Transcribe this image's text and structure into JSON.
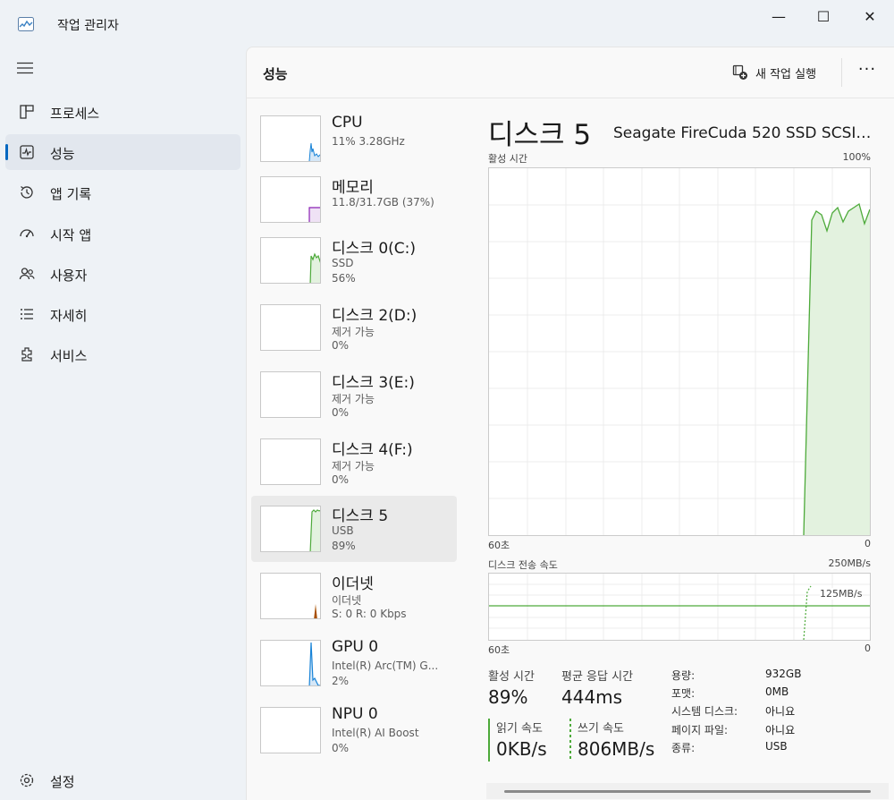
{
  "window": {
    "title": "작업 관리자",
    "minimize": "—",
    "maximize": "☐",
    "close": "✕"
  },
  "nav": {
    "items": [
      {
        "label": "프로세스",
        "icon": "processes-icon"
      },
      {
        "label": "성능",
        "icon": "performance-icon"
      },
      {
        "label": "앱 기록",
        "icon": "app-history-icon"
      },
      {
        "label": "시작 앱",
        "icon": "startup-apps-icon"
      },
      {
        "label": "사용자",
        "icon": "users-icon"
      },
      {
        "label": "자세히",
        "icon": "details-icon"
      },
      {
        "label": "서비스",
        "icon": "services-icon"
      }
    ],
    "settings_label": "설정"
  },
  "header": {
    "title": "성능",
    "new_task_label": "새 작업 실행",
    "more_label": "···"
  },
  "devices": [
    {
      "name": "CPU",
      "sub1": "11% 3.28GHz",
      "sub2": "",
      "color": "#1883d7"
    },
    {
      "name": "메모리",
      "sub1": "11.8/31.7GB (37%)",
      "sub2": "",
      "color": "#8b21b5"
    },
    {
      "name": "디스크 0(C:)",
      "sub1": "SSD",
      "sub2": "56%",
      "color": "#4daa3a"
    },
    {
      "name": "디스크 2(D:)",
      "sub1": "제거 가능",
      "sub2": "0%",
      "color": "#4daa3a"
    },
    {
      "name": "디스크 3(E:)",
      "sub1": "제거 가능",
      "sub2": "0%",
      "color": "#4daa3a"
    },
    {
      "name": "디스크 4(F:)",
      "sub1": "제거 가능",
      "sub2": "0%",
      "color": "#4daa3a"
    },
    {
      "name": "디스크 5",
      "sub1": "USB",
      "sub2": "89%",
      "color": "#4daa3a"
    },
    {
      "name": "이더넷",
      "sub1": "이더넷",
      "sub2": "S: 0 R: 0 Kbps",
      "color": "#a74f01"
    },
    {
      "name": "GPU 0",
      "sub1": "Intel(R) Arc(TM) G...",
      "sub2": "2%",
      "color": "#1883d7"
    },
    {
      "name": "NPU 0",
      "sub1": "Intel(R) AI Boost",
      "sub2": "0%",
      "color": "#1883d7"
    }
  ],
  "detail": {
    "title": "디스크 5",
    "model": "Seagate FireCuda 520 SSD SCSI ...",
    "graph1": {
      "label": "활성 시간",
      "max": "100%",
      "time": "60초",
      "min": "0"
    },
    "graph2": {
      "label": "디스크 전송 속도",
      "max": "250MB/s",
      "mid": "125MB/s",
      "time": "60초",
      "min": "0"
    },
    "stats": {
      "active_label": "활성 시간",
      "active_value": "89%",
      "response_label": "평균 응답 시간",
      "response_value": "444ms",
      "read_label": "읽기 속도",
      "read_value": "0KB/s",
      "write_label": "쓰기 속도",
      "write_value": "806MB/s"
    },
    "props": [
      {
        "key": "용량:",
        "value": "932GB"
      },
      {
        "key": "포맷:",
        "value": "0MB"
      },
      {
        "key": "시스템 디스크:",
        "value": "아니요"
      },
      {
        "key": "페이지 파일:",
        "value": "아니요"
      },
      {
        "key": "종류:",
        "value": "USB"
      }
    ]
  },
  "colors": {
    "accent": "#0067c0",
    "disk_green": "#4daa3a"
  }
}
